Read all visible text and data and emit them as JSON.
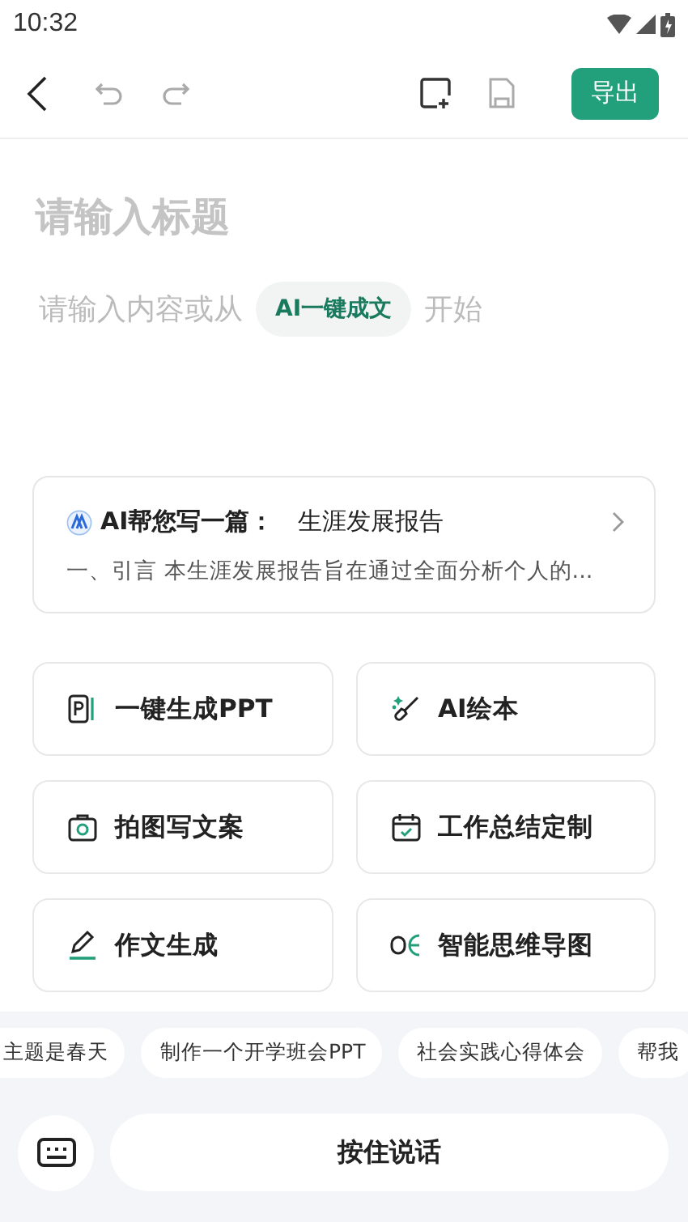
{
  "status_bar": {
    "time": "10:32"
  },
  "toolbar": {
    "export_label": "导出"
  },
  "editor": {
    "title_placeholder": "请输入标题",
    "content_prefix": "请输入内容或从",
    "ai_chip": "AI一键成文",
    "content_suffix": "开始"
  },
  "ai_card": {
    "title": "AI帮您写一篇：",
    "topic": "生涯发展报告",
    "preview": "一、引言 本生涯发展报告旨在通过全面分析个人的..."
  },
  "tools": [
    {
      "kind": "ppt",
      "label": "一键生成PPT"
    },
    {
      "kind": "paint",
      "label": "AI绘本"
    },
    {
      "kind": "camera",
      "label": "拍图写文案"
    },
    {
      "kind": "calendar",
      "label": "工作总结定制"
    },
    {
      "kind": "pen",
      "label": "作文生成"
    },
    {
      "kind": "mindmap",
      "label": "智能思维导图"
    }
  ],
  "suggestions": [
    "主题是春天",
    "制作一个开学班会PPT",
    "社会实践心得体会",
    "帮我"
  ],
  "voice_input": {
    "label": "按住说话"
  }
}
